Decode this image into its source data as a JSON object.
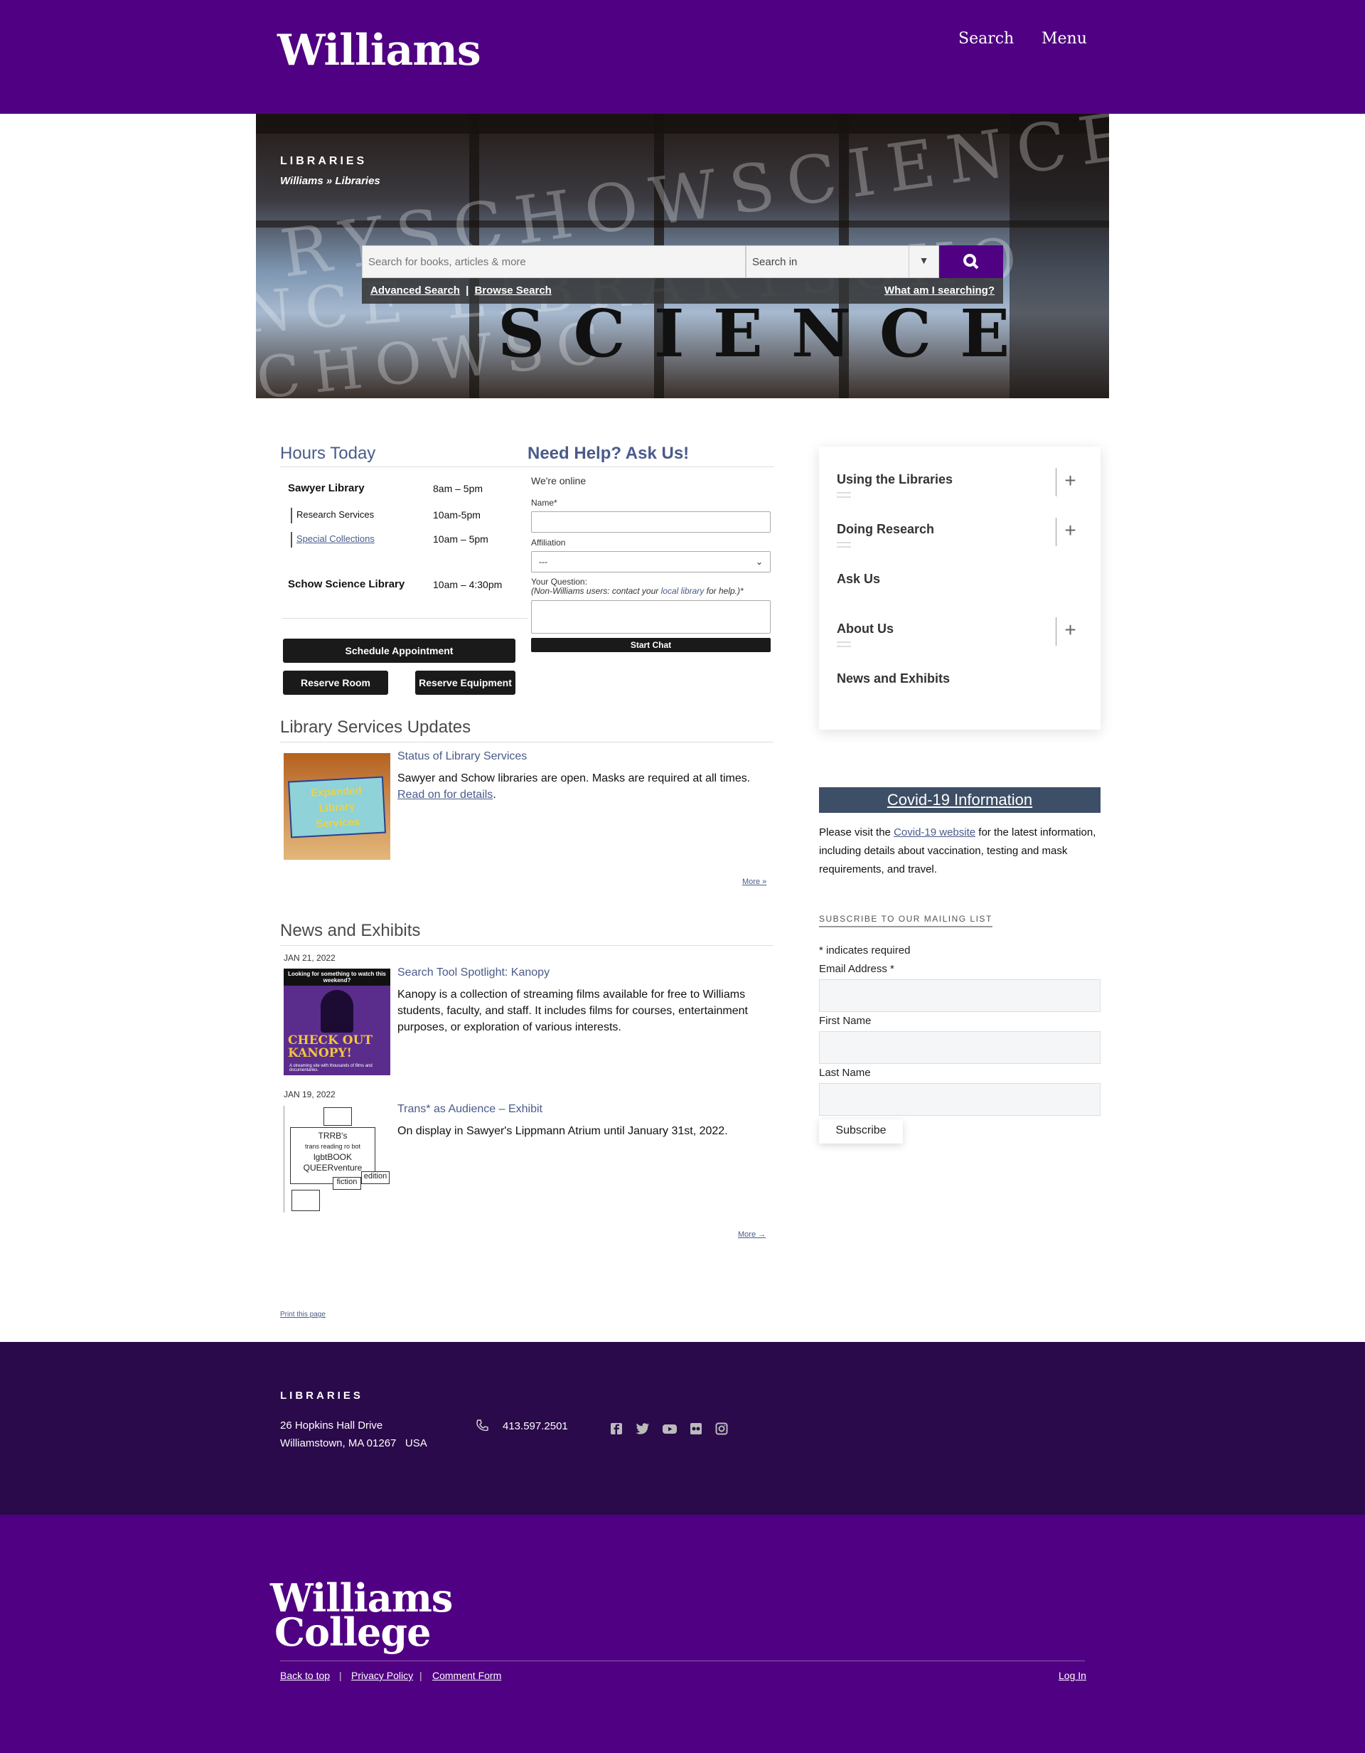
{
  "header": {
    "logo": "Williams",
    "search_label": "Search",
    "menu_label": "Menu"
  },
  "hero": {
    "section_title": "LIBRARIES",
    "breadcrumb": "Williams » Libraries",
    "bg_text_1": "RYSCHOWSCIENCE",
    "bg_text_2": "NCE  LIBRARYSCHO",
    "bg_text_3": "CHOWSC",
    "science": "SCIENCE",
    "search": {
      "placeholder": "Search for books, articles & more",
      "scope_label": "Search in",
      "advanced": "Advanced Search",
      "separator": "|",
      "browse": "Browse Search",
      "what": "What am I searching?"
    }
  },
  "hours": {
    "title": "Hours Today",
    "rows": [
      {
        "name": "Sawyer Library",
        "time": "8am – 5pm"
      },
      {
        "name": "Research Services",
        "time": "10am-5pm"
      },
      {
        "name": "Special Collections",
        "time": "10am – 5pm"
      },
      {
        "name": "Schow Science Library",
        "time": "10am – 4:30pm"
      }
    ],
    "buttons": {
      "schedule": "Schedule Appointment",
      "room": "Reserve Room",
      "equipment": "Reserve Equipment"
    }
  },
  "help": {
    "title": "Need Help? Ask Us!",
    "status": "We're online",
    "name_label": "Name*",
    "affiliation_label": "Affiliation",
    "affiliation_value": "---",
    "question_label": "Your Question:",
    "question_note_1": "(Non-Williams users: contact your ",
    "question_note_link": "local library",
    "question_note_2": " for help.)*",
    "start": "Start Chat"
  },
  "updates": {
    "title": "Library Services Updates",
    "post_title": "Status of Library Services",
    "post_body": "Sawyer and Schow libraries are open. Masks are required at all times.",
    "post_link": "Read on for details",
    "post_end": ".",
    "image_text_1": "Expanded",
    "image_text_2": "Library",
    "image_text_3": "Services",
    "more": "More »"
  },
  "news": {
    "title": "News and Exhibits",
    "items": [
      {
        "date": "JAN 21, 2022",
        "title": "Search Tool Spotlight: Kanopy",
        "body": "Kanopy is a collection of streaming films available for free to Williams students, faculty, and staff.  It includes films for courses, entertainment purposes, or exploration of various interests.",
        "img_top": "Looking for something to watch this weekend?",
        "img_main": "CHECK OUT KANOPY!",
        "img_small": "A streaming site with thousands of films and documentaries."
      },
      {
        "date": "JAN 19, 2022",
        "title": "Trans* as Audience – Exhibit",
        "body": "On display in Sawyer's Lippmann Atrium until January 31st, 2022.",
        "img_l1": "TRRB's",
        "img_l2": "trans reading ro bot",
        "img_l3": "lgbtBOOK",
        "img_l4": "QUEERventure",
        "img_l5": "fiction",
        "img_l6": "edition"
      }
    ],
    "more": "More →"
  },
  "print": "Print this page",
  "sidebar": {
    "items": [
      {
        "label": "Using the Libraries"
      },
      {
        "label": "Doing Research"
      },
      {
        "label": "Ask Us"
      },
      {
        "label": "About Us"
      },
      {
        "label": "News and Exhibits"
      }
    ],
    "plus": "+"
  },
  "covid": {
    "title": "Covid-19 Information",
    "text_1": "Please visit the ",
    "link": "Covid-19 website",
    "text_2": " for the latest information, including details about vaccination, testing and mask requirements, and travel."
  },
  "subscribe": {
    "title": "SUBSCRIBE TO OUR MAILING LIST",
    "required_note": "* indicates required",
    "email_label": "Email Address *",
    "first_label": "First Name",
    "last_label": "Last Name",
    "button": "Subscribe"
  },
  "footer": {
    "title": "LIBRARIES",
    "address_1": "26 Hopkins Hall Drive",
    "address_2": "Williamstown, MA 01267   USA",
    "phone": "413.597.2501",
    "logo_1": "Williams",
    "logo_2": "College",
    "links": {
      "back": "Back to top",
      "privacy": "Privacy Policy",
      "comment": "Comment Form",
      "login": "Log In",
      "sep": "|"
    }
  },
  "colors": {
    "purple": "#500082",
    "dark_purple": "#2a0a4a",
    "link_blue": "#4a5b8a",
    "covid_bar": "#3d4f66"
  },
  "icons": [
    "search-icon",
    "caret-down-icon",
    "phone-icon",
    "facebook-icon",
    "twitter-icon",
    "youtube-icon",
    "flickr-icon",
    "instagram-icon",
    "plus-icon"
  ]
}
